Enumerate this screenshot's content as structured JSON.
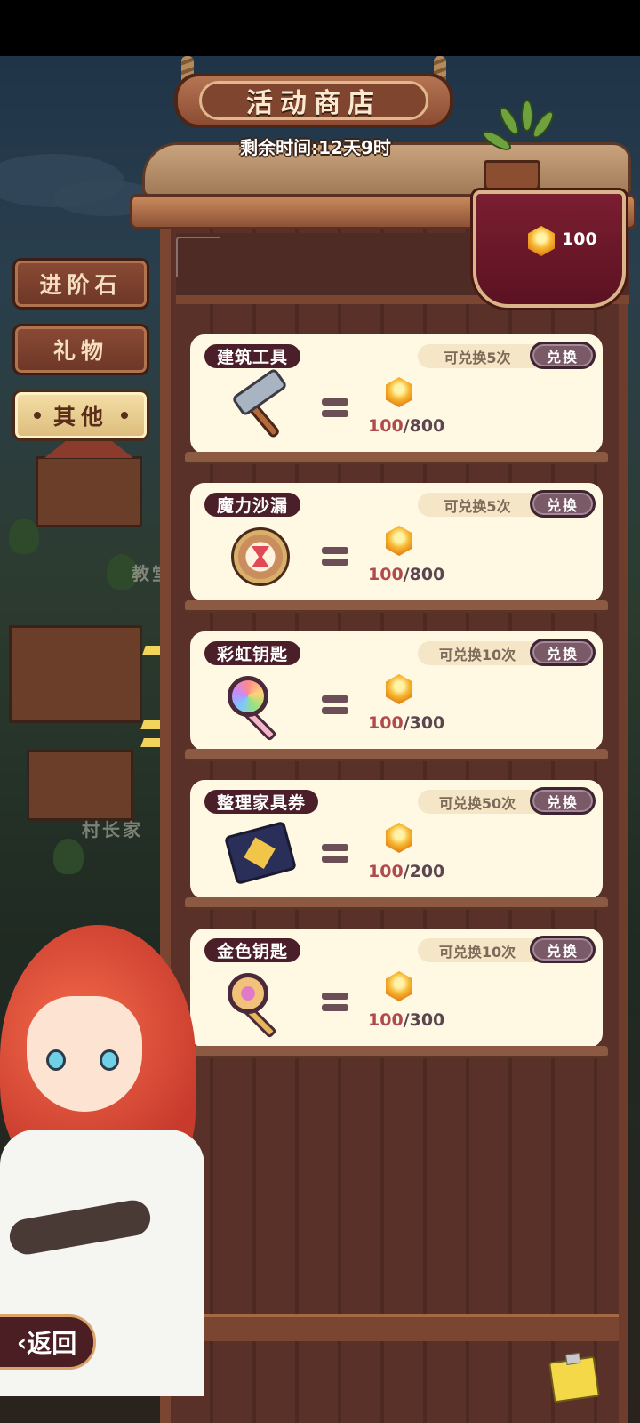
{
  "shop": {
    "title": "活动商店",
    "timer": "剩余时间:12天9时",
    "currency_amount": "100"
  },
  "tabs": [
    {
      "label": "进阶石",
      "active": false
    },
    {
      "label": "礼物",
      "active": false
    },
    {
      "label": "其他",
      "active": true
    }
  ],
  "items": [
    {
      "name": "建筑工具",
      "limit": "可兑换5次",
      "button": "兑换",
      "owned": "100",
      "cost": "/800",
      "icon": "hammer-icon"
    },
    {
      "name": "魔力沙漏",
      "limit": "可兑换5次",
      "button": "兑换",
      "owned": "100",
      "cost": "/800",
      "icon": "hourglass-icon"
    },
    {
      "name": "彩虹钥匙",
      "limit": "可兑换10次",
      "button": "兑换",
      "owned": "100",
      "cost": "/300",
      "icon": "rainbow-key-icon"
    },
    {
      "name": "整理家具券",
      "limit": "可兑换50次",
      "button": "兑换",
      "owned": "100",
      "cost": "/200",
      "icon": "furniture-ticket-icon"
    },
    {
      "name": "金色钥匙",
      "limit": "可兑换10次",
      "button": "兑换",
      "owned": "100",
      "cost": "/300",
      "icon": "golden-key-icon"
    }
  ],
  "scene_labels": [
    "教堂",
    "村长家"
  ],
  "back_button": {
    "label": "返回"
  },
  "colors": {
    "accent": "#4a1f2a",
    "card_bg": "#fff8e2",
    "owned_value": "#b04a4e",
    "banner": "#7a1e30"
  }
}
